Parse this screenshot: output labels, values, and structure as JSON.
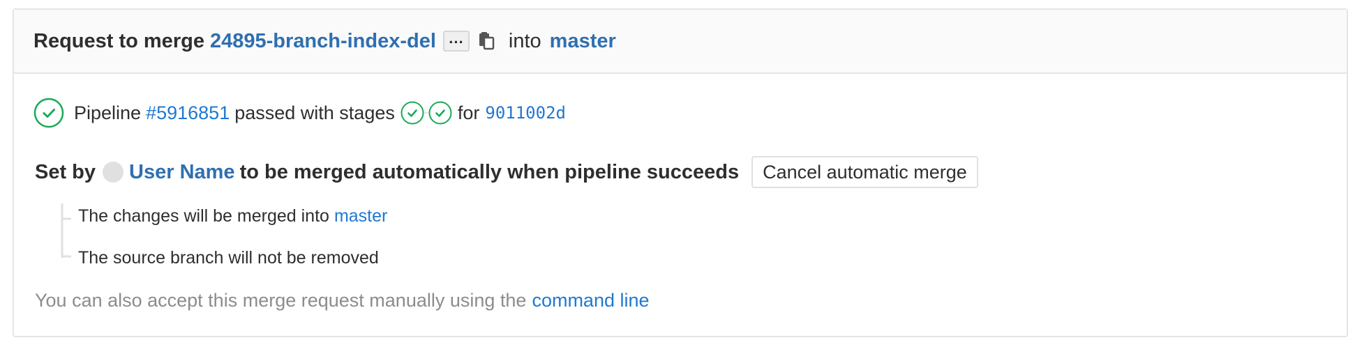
{
  "header": {
    "prefix": "Request to merge",
    "source_branch": "24895-branch-index-del",
    "ellipsis": "...",
    "copy_icon": "clipboard-icon",
    "into": "into",
    "target_branch": "master"
  },
  "pipeline": {
    "status_icon": "status-success-icon",
    "label": "Pipeline",
    "id": "#5916851",
    "passed_text": "passed with stages",
    "stages": [
      {
        "icon": "status-success-icon",
        "status": "passed"
      },
      {
        "icon": "status-success-icon",
        "status": "passed"
      }
    ],
    "for_text": "for",
    "commit": "9011002d",
    "success_color": "#1aaa55"
  },
  "auto_merge": {
    "set_by": "Set by",
    "user": "User Name",
    "message": "to be merged automatically when pipeline succeeds",
    "cancel_label": "Cancel automatic merge"
  },
  "details": {
    "merged_into_prefix": "The changes will be merged into",
    "merged_into_branch": "master",
    "source_branch_note": "The source branch will not be removed"
  },
  "footer": {
    "text": "You can also accept this merge request manually using the",
    "link": "command line"
  }
}
